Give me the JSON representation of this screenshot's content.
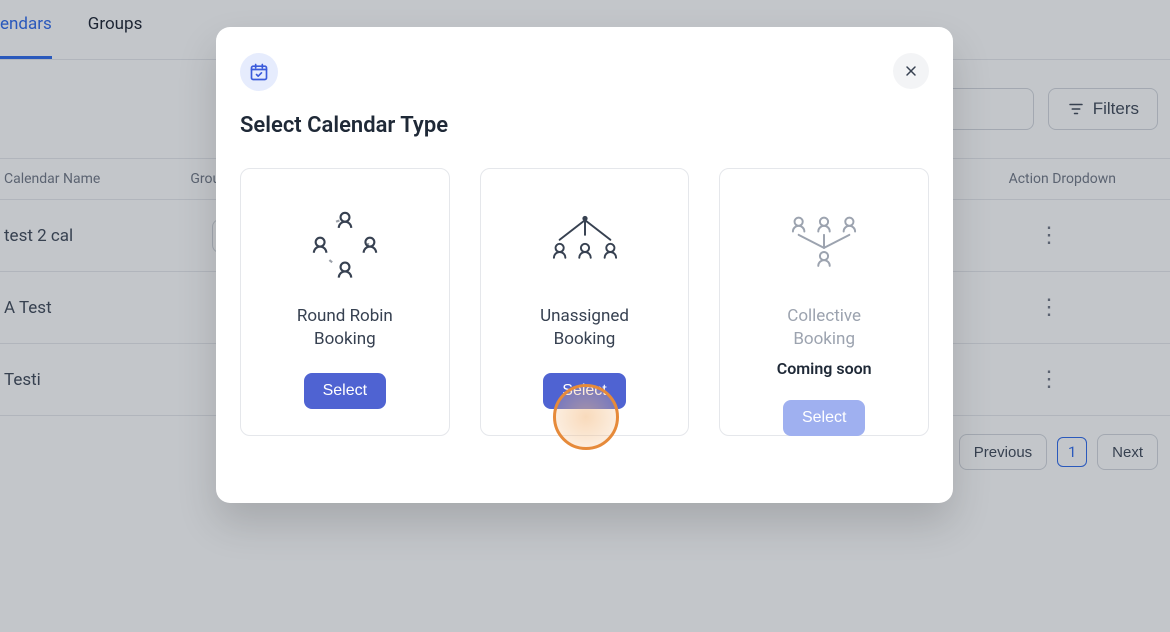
{
  "tabs": {
    "calendars": "endars",
    "groups": "Groups"
  },
  "toolbar": {
    "search_placeholder": "",
    "filters_label": "Filters"
  },
  "table": {
    "header_calendar_name": "Calendar Name",
    "header_group_prefix": "Grou",
    "header_action": "Action Dropdown",
    "rows": [
      {
        "name": "test 2 cal",
        "has_folder": true
      },
      {
        "name": "A Test",
        "has_folder": false
      },
      {
        "name": "Testi",
        "has_folder": false
      }
    ]
  },
  "pagination": {
    "previous": "Previous",
    "page": "1",
    "next": "Next"
  },
  "modal": {
    "title": "Select Calendar Type",
    "cards": [
      {
        "label": "Round Robin\nBooking",
        "select": "Select"
      },
      {
        "label": "Unassigned\nBooking",
        "select": "Select"
      },
      {
        "label": "Collective\nBooking",
        "coming_soon": "Coming soon",
        "select": "Select"
      }
    ]
  }
}
